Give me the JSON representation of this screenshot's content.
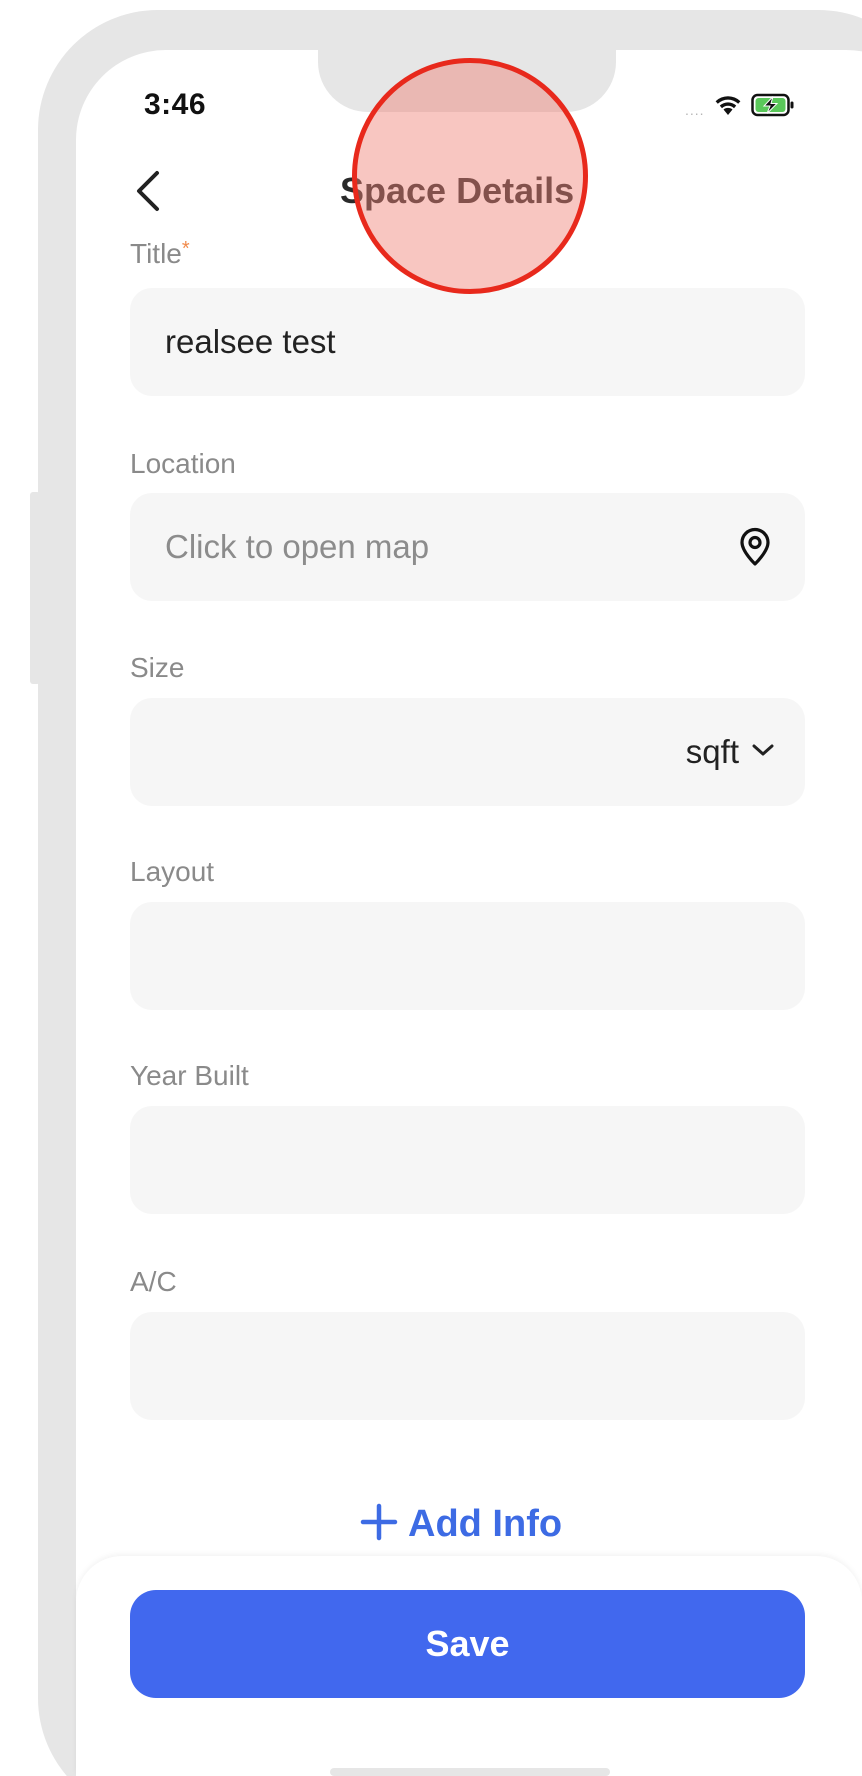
{
  "status_bar": {
    "time": "3:46",
    "signal": "....",
    "icons": [
      "wifi-icon",
      "battery-charging-icon"
    ]
  },
  "nav": {
    "back_icon": "chevron-left-icon",
    "title": "Space Details"
  },
  "form": {
    "title": {
      "label": "Title",
      "required_mark": "*",
      "value": "realsee test"
    },
    "location": {
      "label": "Location",
      "placeholder": "Click to open map",
      "icon": "location-pin-icon"
    },
    "size": {
      "label": "Size",
      "value": "",
      "unit": "sqft",
      "unit_icon": "chevron-down-icon"
    },
    "layout": {
      "label": "Layout",
      "value": ""
    },
    "year_built": {
      "label": "Year Built",
      "value": ""
    },
    "ac": {
      "label": "A/C",
      "value": ""
    }
  },
  "actions": {
    "add_info_label": "Add Info",
    "add_info_icon": "plus-icon",
    "save_label": "Save"
  },
  "colors": {
    "accent": "#4168EE",
    "link": "#3D6BE4",
    "required": "#F08A4B",
    "field_background": "#F6F6F6",
    "frame": "#E6E6E6",
    "tap_marker": "#E8291C"
  }
}
